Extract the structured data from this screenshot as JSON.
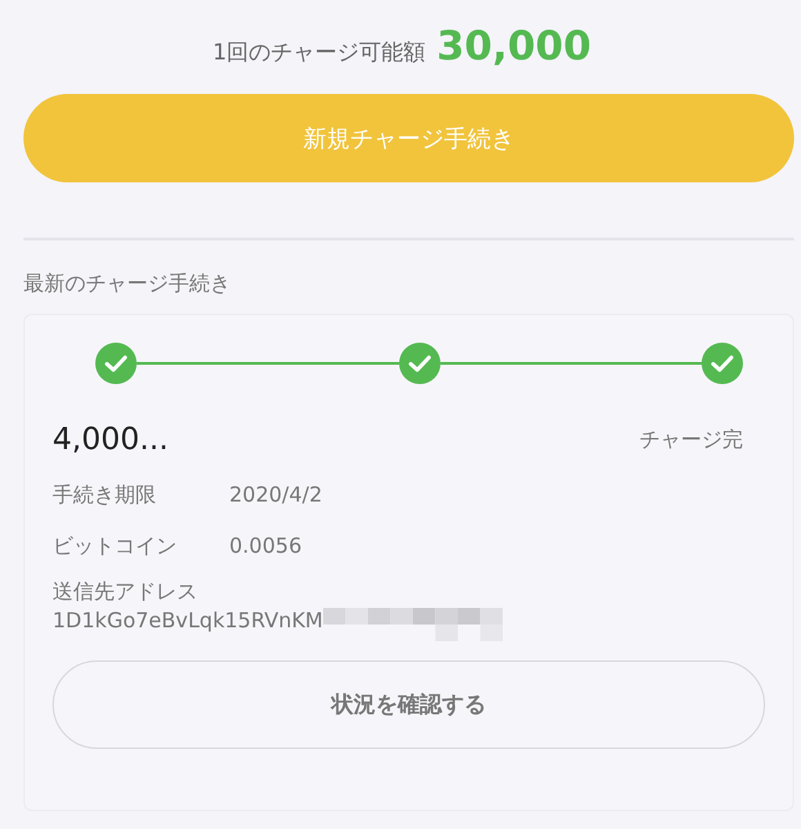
{
  "limit": {
    "label": "1回のチャージ可能額",
    "amount": "30,000"
  },
  "new_charge_button": {
    "label": "新規チャージ手続き"
  },
  "latest": {
    "heading": "最新のチャージ手続き",
    "steps": [
      {
        "done": true
      },
      {
        "done": true
      },
      {
        "done": true
      }
    ],
    "amount": "4,000...",
    "status": "チャージ完",
    "details": [
      {
        "label": "手続き期限",
        "value": "2020/4/2"
      },
      {
        "label": "ビットコイン",
        "value": "0.0056"
      }
    ],
    "address": {
      "label": "送信先アドレス",
      "value": "1D1kGo7eBvLqk15RVnKM",
      "redacted": true
    },
    "check_button": {
      "label": "状況を確認する"
    }
  }
}
